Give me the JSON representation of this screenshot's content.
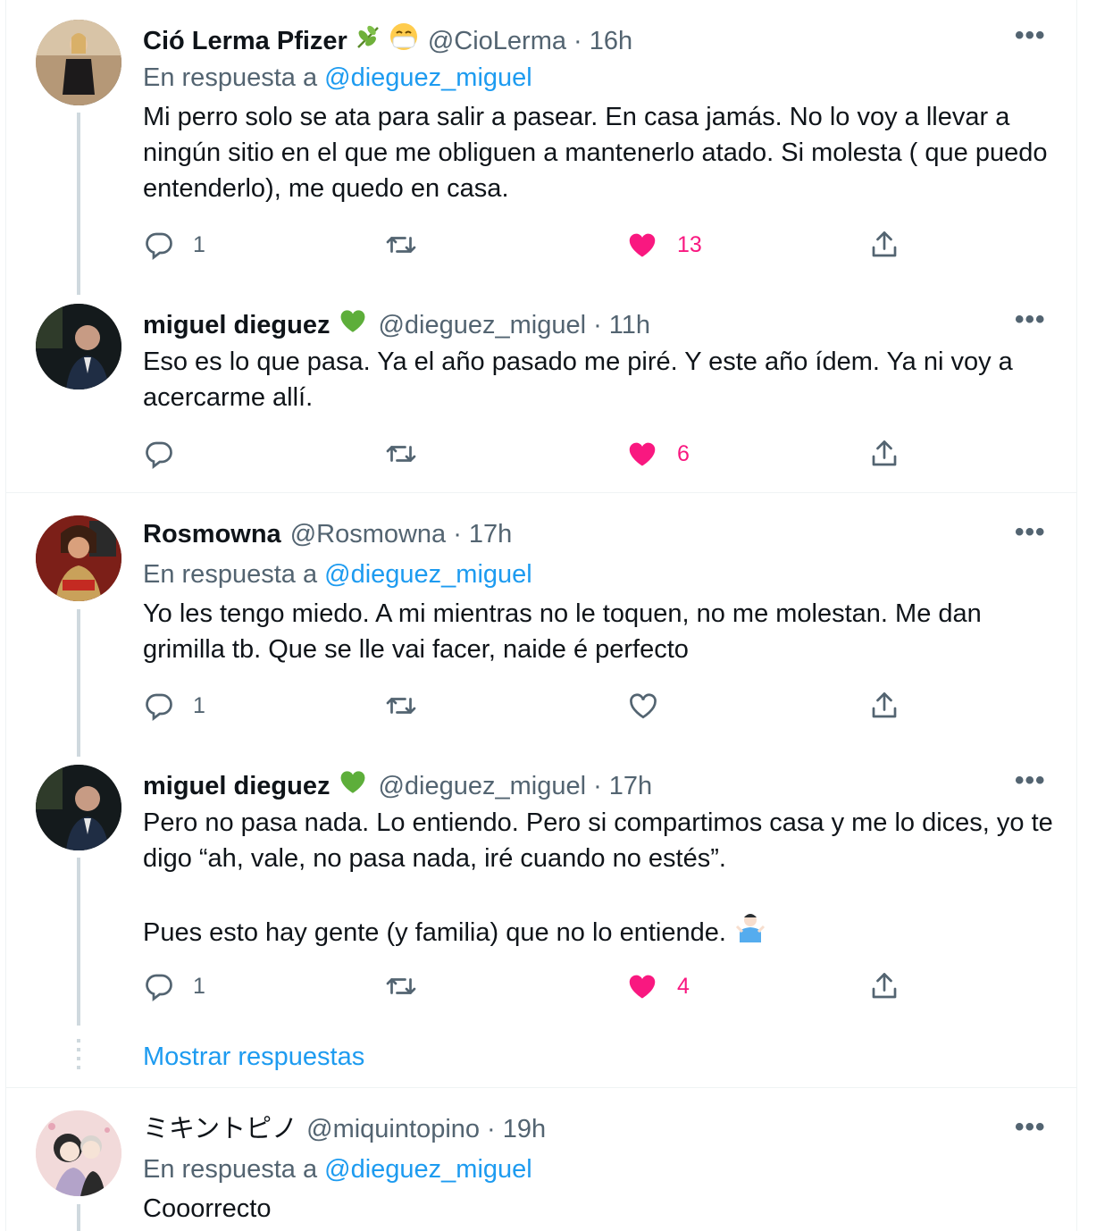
{
  "colors": {
    "accent": "#1d9bf0",
    "like": "#f91880",
    "muted": "#536471",
    "thread_line": "#cfd9de",
    "green_heart": "#5dae3a"
  },
  "icons": {
    "reply": "reply-icon",
    "retweet": "retweet-icon",
    "like": "heart-icon",
    "share": "share-icon",
    "more": "more-options-icon"
  },
  "tweets": [
    {
      "name": "Ció Lerma Pfizer",
      "handle": "@CioLerma",
      "time": "· 16h",
      "reply_prefix": "En respuesta a",
      "reply_to": "@dieguez_miguel",
      "text": "Mi perro solo se ata para salir a pasear. En casa jamás.  No lo voy a llevar a ningún sitio en el que me obliguen a mantenerlo atado. Si molesta ( que puedo entenderlo), me quedo en casa.",
      "reply_count": "1",
      "like_count": "13",
      "liked": true
    },
    {
      "name": "miguel dieguez",
      "handle": "@dieguez_miguel",
      "time": "· 11h",
      "text": "Eso es lo que pasa. Ya el año pasado me piré. Y este año ídem. Ya ni voy a acercarme allí.",
      "like_count": "6",
      "liked": true
    },
    {
      "name": "Rosmowna",
      "handle": "@Rosmowna",
      "time": "· 17h",
      "reply_prefix": "En respuesta a",
      "reply_to": "@dieguez_miguel",
      "text": "Yo les tengo miedo. A mi mientras no le toquen, no me molestan.  Me dan grimilla tb. Que se lle vai facer, naide é perfecto",
      "reply_count": "1",
      "liked": false
    },
    {
      "name": "miguel dieguez",
      "handle": "@dieguez_miguel",
      "time": "· 17h",
      "text_line1": "Pero no pasa nada. Lo entiendo. Pero si compartimos casa y me lo dices, yo te digo “ah, vale, no pasa nada, iré cuando no estés”.",
      "text_line2": "Pues esto hay gente (y familia) que no lo entiende.",
      "reply_count": "1",
      "like_count": "4",
      "liked": true
    },
    {
      "name": "ミキントピノ",
      "handle": "@miquintopino",
      "time": "· 19h",
      "reply_prefix": "En respuesta a",
      "reply_to": "@dieguez_miguel",
      "text": "Cooorrecto"
    }
  ],
  "show_replies": "Mostrar respuestas"
}
